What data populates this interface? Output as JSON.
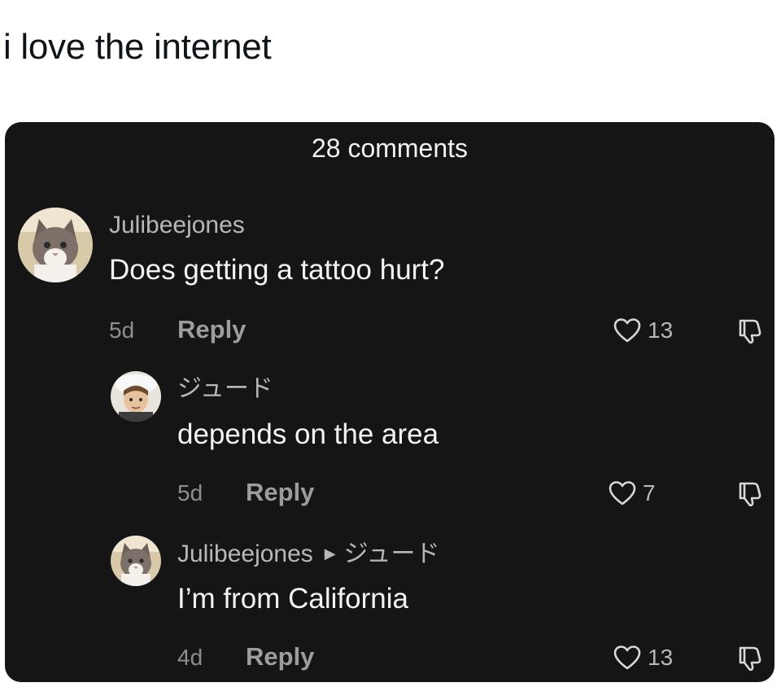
{
  "post": {
    "text": "i love the internet"
  },
  "comments_panel": {
    "header": "28 comments",
    "comments": [
      {
        "username": "Julibeejones",
        "reply_to": "",
        "text": "Does getting a tattoo hurt?",
        "time": "5d",
        "reply_label": "Reply",
        "likes": "13",
        "avatar": "cat-avatar"
      },
      {
        "username": "ジュード",
        "reply_to": "",
        "text": "depends on the area",
        "time": "5d",
        "reply_label": "Reply",
        "likes": "7",
        "avatar": "anime-character-avatar"
      },
      {
        "username": "Julibeejones",
        "reply_to": "ジュード",
        "text": "I’m from California",
        "time": "4d",
        "reply_label": "Reply",
        "likes": "13",
        "avatar": "cat-avatar"
      }
    ]
  },
  "colors": {
    "panel_background": "#151515",
    "primary_text": "#f3f3f3",
    "secondary_text": "#b8b8b8"
  }
}
